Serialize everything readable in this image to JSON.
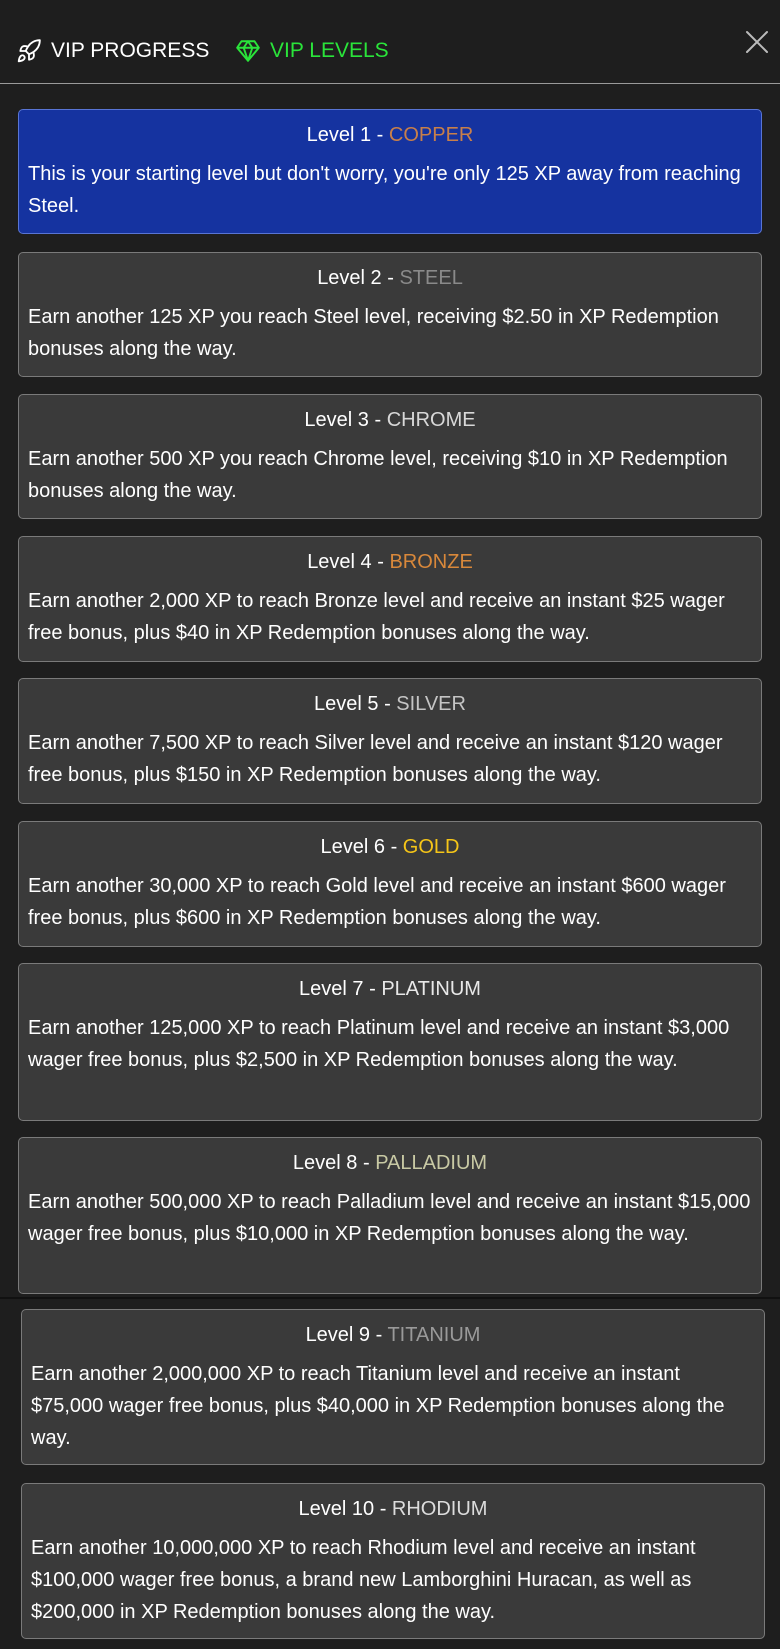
{
  "tabs": {
    "progress_label": "VIP PROGRESS",
    "levels_label": "VIP LEVELS"
  },
  "colors": {
    "active_tab": "#2ae43a",
    "active_card": "#1533a0",
    "card": "#3a3a3a"
  },
  "icons": {
    "progress": "rocket-icon",
    "levels": "diamond-icon",
    "close": "close-icon"
  },
  "levels": [
    {
      "prefix": "Level 1 - ",
      "name": "COPPER",
      "color": "#c87f4a",
      "description": "This is your starting level but don't worry, you're only 125 XP away from reaching Steel."
    },
    {
      "prefix": "Level 2 - ",
      "name": "STEEL",
      "color": "#8a8a8a",
      "description": "Earn another 125 XP you reach Steel level, receiving $2.50 in XP Redemption bonuses along the way."
    },
    {
      "prefix": "Level 3 - ",
      "name": "CHROME",
      "color": "#d8d8d8",
      "description": "Earn another 500 XP you reach Chrome level, receiving $10 in XP Redemption bonuses along the way."
    },
    {
      "prefix": "Level 4 - ",
      "name": "BRONZE",
      "color": "#d9883a",
      "description": "Earn another 2,000 XP to reach Bronze level and receive an instant $25 wager free bonus, plus $40 in XP Redemption bonuses along the way."
    },
    {
      "prefix": "Level 5 - ",
      "name": "SILVER",
      "color": "#c4c4c4",
      "description": "Earn another 7,500 XP to reach Silver level and receive an instant $120 wager free bonus, plus $150 in XP Redemption bonuses along the way."
    },
    {
      "prefix": "Level 6 - ",
      "name": "GOLD",
      "color": "#f5c518",
      "description": "Earn another 30,000 XP to reach Gold level and receive an instant $600 wager free bonus, plus $600 in XP Redemption bonuses along the way."
    },
    {
      "prefix": "Level 7 - ",
      "name": "PLATINUM",
      "color": "#e8e8e8",
      "description": "Earn another 125,000 XP to reach Platinum level and receive an instant $3,000 wager free bonus, plus $2,500 in XP Redemption bonuses along the way."
    },
    {
      "prefix": "Level 8 - ",
      "name": "PALLADIUM",
      "color": "#c8c9a4",
      "description": "Earn another 500,000 XP to reach Palladium level and receive an instant $15,000 wager free bonus, plus $10,000 in XP Redemption bonuses along the way."
    },
    {
      "prefix": "Level 9 - ",
      "name": "TITANIUM",
      "color": "#9a9a9a",
      "description": "Earn another 2,000,000 XP to reach Titanium level and receive an instant $75,000 wager free bonus, plus $40,000 in XP Redemption bonuses along the way."
    },
    {
      "prefix": "Level 10 - ",
      "name": "RHODIUM",
      "color": "#dcdcdc",
      "description": "Earn another 10,000,000 XP to reach Rhodium level and receive an instant $100,000 wager free bonus, a brand new Lamborghini Huracan, as well as $200,000 in XP Redemption bonuses along the way."
    }
  ]
}
